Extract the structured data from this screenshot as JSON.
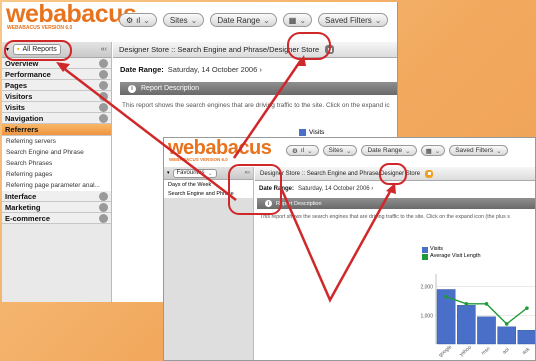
{
  "app": {
    "logo": "webabacus",
    "version": "WEBABACUS VERSION 6.0"
  },
  "toolbar": {
    "sites": "Sites",
    "date_range": "Date Range",
    "saved_filters": "Saved Filters"
  },
  "panel1": {
    "tab_label": "All Reports",
    "breadcrumb": "Designer Store :: Search Engine and Phrase/Designer Store",
    "date_label": "Date Range:",
    "date_value": "Saturday, 14 October 2006",
    "description_title": "Report Description",
    "description_text": "This report shows the search engines that are driving traffic to the site. Click on the expand ic",
    "nav": [
      {
        "label": "Overview"
      },
      {
        "label": "Performance"
      },
      {
        "label": "Pages"
      },
      {
        "label": "Visitors"
      },
      {
        "label": "Visits"
      },
      {
        "label": "Navigation"
      },
      {
        "label": "Referrers"
      }
    ],
    "referrer_items": [
      "Referring servers",
      "Search Engine and Phrase",
      "Search Phrases",
      "Referring pages",
      "Referring page parameter anal..."
    ],
    "nav2": [
      {
        "label": "Interface"
      },
      {
        "label": "Marketing"
      },
      {
        "label": "E-commerce"
      }
    ],
    "legend_visits": "Visits"
  },
  "panel2": {
    "tab_label": "Favourites",
    "favourites": [
      "Days of the Week",
      "Search Engine and Phrase"
    ],
    "breadcrumb": "Designer Store :: Search Engine and Phrase/Designer Store",
    "date_label": "Date Range:",
    "date_value": "Saturday, 14 October 2006",
    "description_title": "Report Description",
    "description_text": "This report shows the search engines that are driving traffic to the site. Click on the expand icon (the plus s"
  },
  "chart_data": {
    "type": "bar",
    "series": [
      {
        "name": "Visits",
        "type": "bar",
        "values": [
          1900,
          1350,
          950,
          600,
          480
        ]
      },
      {
        "name": "Average Visit Length",
        "type": "line",
        "values": [
          1650,
          1400,
          1400,
          700,
          1250
        ]
      }
    ],
    "y_ticks": [
      2000,
      1000
    ],
    "x_labels": [
      "google",
      "yahoo",
      "msn",
      "aol",
      "ask"
    ],
    "ylim": [
      0,
      2300
    ],
    "colors": {
      "bars": "#4a6fc8",
      "line": "#1f9a3a"
    }
  }
}
